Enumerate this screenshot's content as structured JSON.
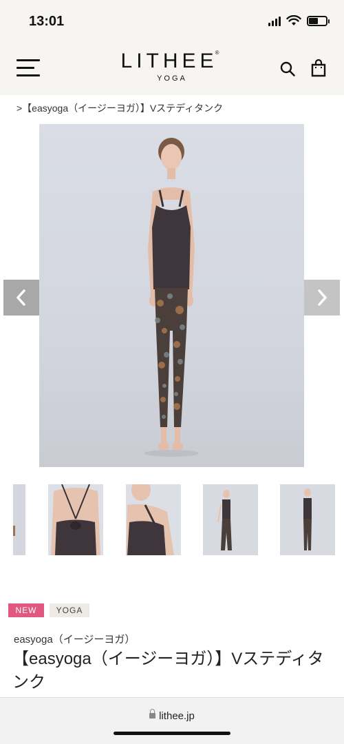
{
  "status_bar": {
    "time": "13:01",
    "battery_level": 0.55,
    "icons": [
      "signal-icon",
      "wifi-icon",
      "battery-icon"
    ]
  },
  "header": {
    "logo": "LITHEE",
    "logo_mark": "®",
    "logo_sub": "YOGA",
    "icons": [
      "menu-icon",
      "search-icon",
      "shopping-bag-icon"
    ]
  },
  "breadcrumb": {
    "current": ">【easyoga（イージーヨガ）】Vステディタンク"
  },
  "gallery": {
    "thumbnail_count": 5,
    "prev_icon": "chevron-left-icon",
    "next_icon": "chevron-right-icon"
  },
  "product": {
    "tags": [
      "NEW",
      "YOGA"
    ],
    "brand": "easyoga（イージーヨガ）",
    "title": "【easyoga（イージーヨガ）】Vステディタンク"
  },
  "browser": {
    "url": "lithee.jp"
  },
  "colors": {
    "tag_new": "#e0577f",
    "tag_yoga": "#ede9e4",
    "header_bg": "#f7f5f2",
    "image_bg": "#d6d8df"
  }
}
